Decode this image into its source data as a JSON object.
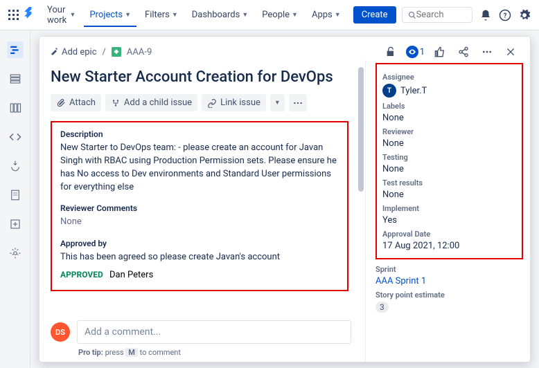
{
  "topnav": {
    "items": [
      "Your work",
      "Projects",
      "Filters",
      "Dashboards",
      "People",
      "Apps"
    ],
    "active_index": 1,
    "create_label": "Create",
    "search_placeholder": "Search"
  },
  "breadcrumb": {
    "add_epic": "Add epic",
    "issue_key": "AAA-9"
  },
  "issue": {
    "title": "New Starter Account Creation for DevOps",
    "toolbar": {
      "attach": "Attach",
      "add_child": "Add a child issue",
      "link": "Link issue"
    },
    "description_label": "Description",
    "description_text": "New Starter to DevOps team: - please create an account for Javan Singh with RBAC using Production Permission sets. Please ensure he has No access to Dev environments and Standard User permissions for everything else",
    "reviewer_comments_label": "Reviewer Comments",
    "reviewer_comments_value": "None",
    "approved_by_label": "Approved by",
    "approved_by_text": "This has been agreed so please create Javan's account",
    "approved_badge": "APPROVED",
    "approver_name": "Dan Peters",
    "watch_count": "1"
  },
  "side": {
    "assignee_label": "Assignee",
    "assignee_initial": "T",
    "assignee_name": "Tyler.T",
    "labels_label": "Labels",
    "labels_value": "None",
    "reviewer_label": "Reviewer",
    "reviewer_value": "None",
    "testing_label": "Testing",
    "testing_value": "None",
    "test_results_label": "Test results",
    "test_results_value": "None",
    "implement_label": "Implement",
    "implement_value": "Yes",
    "approval_date_label": "Approval Date",
    "approval_date_value": "17 Aug 2021, 12:00",
    "sprint_label": "Sprint",
    "sprint_value": "AAA Sprint 1",
    "story_points_label": "Story point estimate",
    "story_points_value": "3"
  },
  "comment": {
    "avatar_initials": "DS",
    "placeholder": "Add a comment...",
    "protip_prefix": "Pro tip: ",
    "protip_text": "press ",
    "protip_key": "M",
    "protip_suffix": " to comment"
  }
}
